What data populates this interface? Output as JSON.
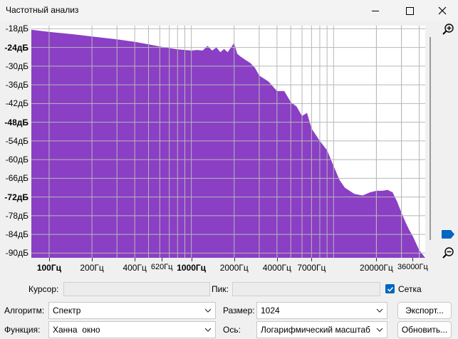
{
  "window": {
    "title": "Частотный анализ"
  },
  "chart_data": {
    "type": "area",
    "xscale": "log",
    "xlim": [
      75,
      44100
    ],
    "ylim": [
      -91.5,
      -17
    ],
    "y_ticks": [
      "-18дБ",
      "-24дБ",
      "-30дБ",
      "-36дБ",
      "-42дБ",
      "-48дБ",
      "-54дБ",
      "-60дБ",
      "-66дБ",
      "-72дБ",
      "-78дБ",
      "-84дБ",
      "-90дБ"
    ],
    "y_bold": [
      "-24дБ",
      "-48дБ",
      "-72дБ"
    ],
    "x_ticks": [
      {
        "label": "100Гц",
        "f": 100,
        "bold": true
      },
      {
        "label": "200Гц",
        "f": 200
      },
      {
        "label": "400Гц",
        "f": 400
      },
      {
        "label": "620Гц",
        "f": 620,
        "small": true
      },
      {
        "label": "1000Гц",
        "f": 1000,
        "bold": true
      },
      {
        "label": "2000Гц",
        "f": 2000
      },
      {
        "label": "4000Гц",
        "f": 4000
      },
      {
        "label": "7000Гц",
        "f": 7000
      },
      {
        "label": "20000Гц",
        "f": 20000
      },
      {
        "label": "36000Гц",
        "f": 36000,
        "small": true
      }
    ],
    "grid": true,
    "fill_color": "#8a3fc4",
    "x": [
      75,
      100,
      150,
      200,
      300,
      400,
      500,
      600,
      700,
      800,
      900,
      1000,
      1100,
      1200,
      1300,
      1400,
      1500,
      1600,
      1700,
      1800,
      1900,
      2000,
      2100,
      2200,
      2400,
      2600,
      2800,
      3000,
      3500,
      4000,
      4500,
      5000,
      5500,
      6000,
      6500,
      7000,
      8000,
      9000,
      10000,
      11000,
      12000,
      14000,
      16000,
      18000,
      20000,
      22000,
      24000,
      26000,
      28000,
      30000,
      32000,
      34000,
      36000,
      40000,
      44100
    ],
    "y": [
      -18.3,
      -19,
      -19.8,
      -20.5,
      -21.4,
      -22.2,
      -23,
      -23.7,
      -24.2,
      -24.6,
      -24.8,
      -25,
      -24.8,
      -25,
      -23.5,
      -25,
      -24,
      -25.5,
      -24.5,
      -25.5,
      -24,
      -22.5,
      -26,
      -26.8,
      -28,
      -29,
      -30.5,
      -33,
      -35,
      -38,
      -38,
      -41.5,
      -43,
      -46,
      -45,
      -50,
      -54,
      -57,
      -62,
      -66.5,
      -69,
      -71,
      -71.5,
      -70.5,
      -70,
      -70,
      -69.7,
      -70.5,
      -73.5,
      -77,
      -80,
      -82.5,
      -84.5,
      -89,
      -91.5
    ]
  },
  "bottom": {
    "cursor_label": "Курсор:",
    "peak_label": "Пик:",
    "grid_label": "Сетка",
    "algorithm_label": "Алгоритм:",
    "algorithm_value": "Спектр",
    "size_label": "Размер:",
    "size_value": "1024",
    "export_label": "Экспорт...",
    "function_label": "Функция:",
    "function_value": "Ханна  окно",
    "axis_label": "Ось:",
    "axis_value": "Логарифмический масштаб",
    "refresh_label": "Обновить..."
  }
}
